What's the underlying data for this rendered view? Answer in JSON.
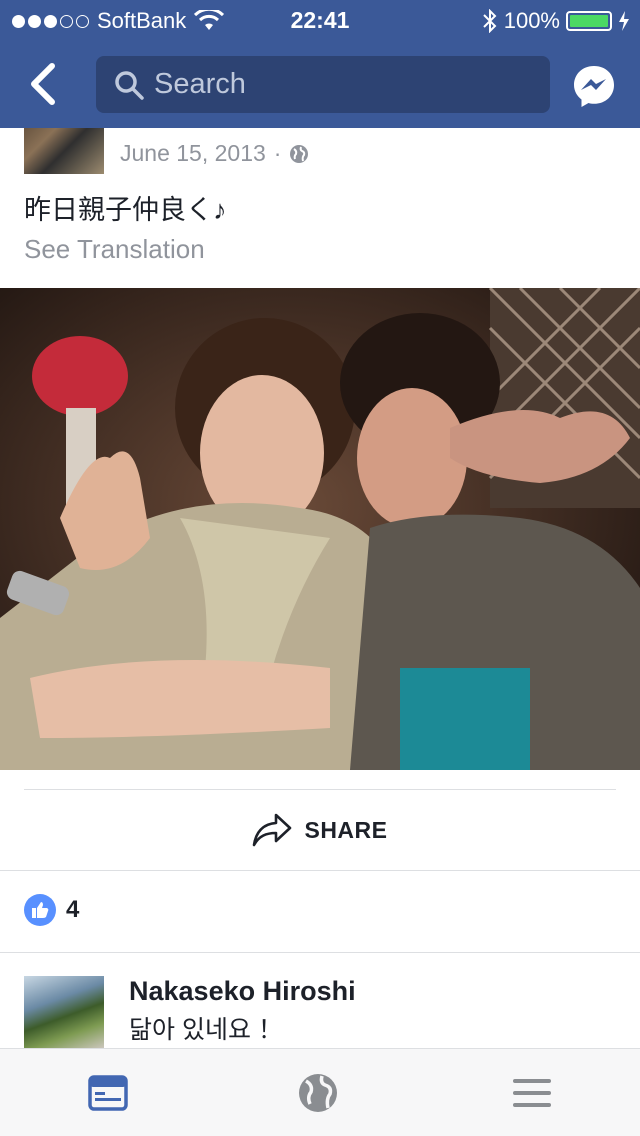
{
  "status_bar": {
    "carrier": "SoftBank",
    "time": "22:41",
    "battery": "100%"
  },
  "nav": {
    "search_placeholder": "Search"
  },
  "post": {
    "date": "June 15, 2013",
    "separator": "·",
    "text": "昨日親子仲良く♪",
    "see_translation": "See Translation"
  },
  "actions": {
    "share_label": "SHARE"
  },
  "likes": {
    "count": "4"
  },
  "comment": {
    "author": "Nakaseko Hiroshi",
    "text": "닮아 있네요 ！"
  },
  "colors": {
    "brand": "#3b5998",
    "like": "#5890ff",
    "active_tab": "#4267b2",
    "muted": "#90949c"
  },
  "icons": {
    "back": "chevron-left-icon",
    "search": "search-icon",
    "messenger": "messenger-icon",
    "globe": "globe-icon",
    "share": "share-arrow-icon",
    "like": "thumbs-up-icon",
    "tab_feed": "news-feed-icon",
    "tab_globe": "globe-icon",
    "tab_menu": "menu-icon"
  }
}
